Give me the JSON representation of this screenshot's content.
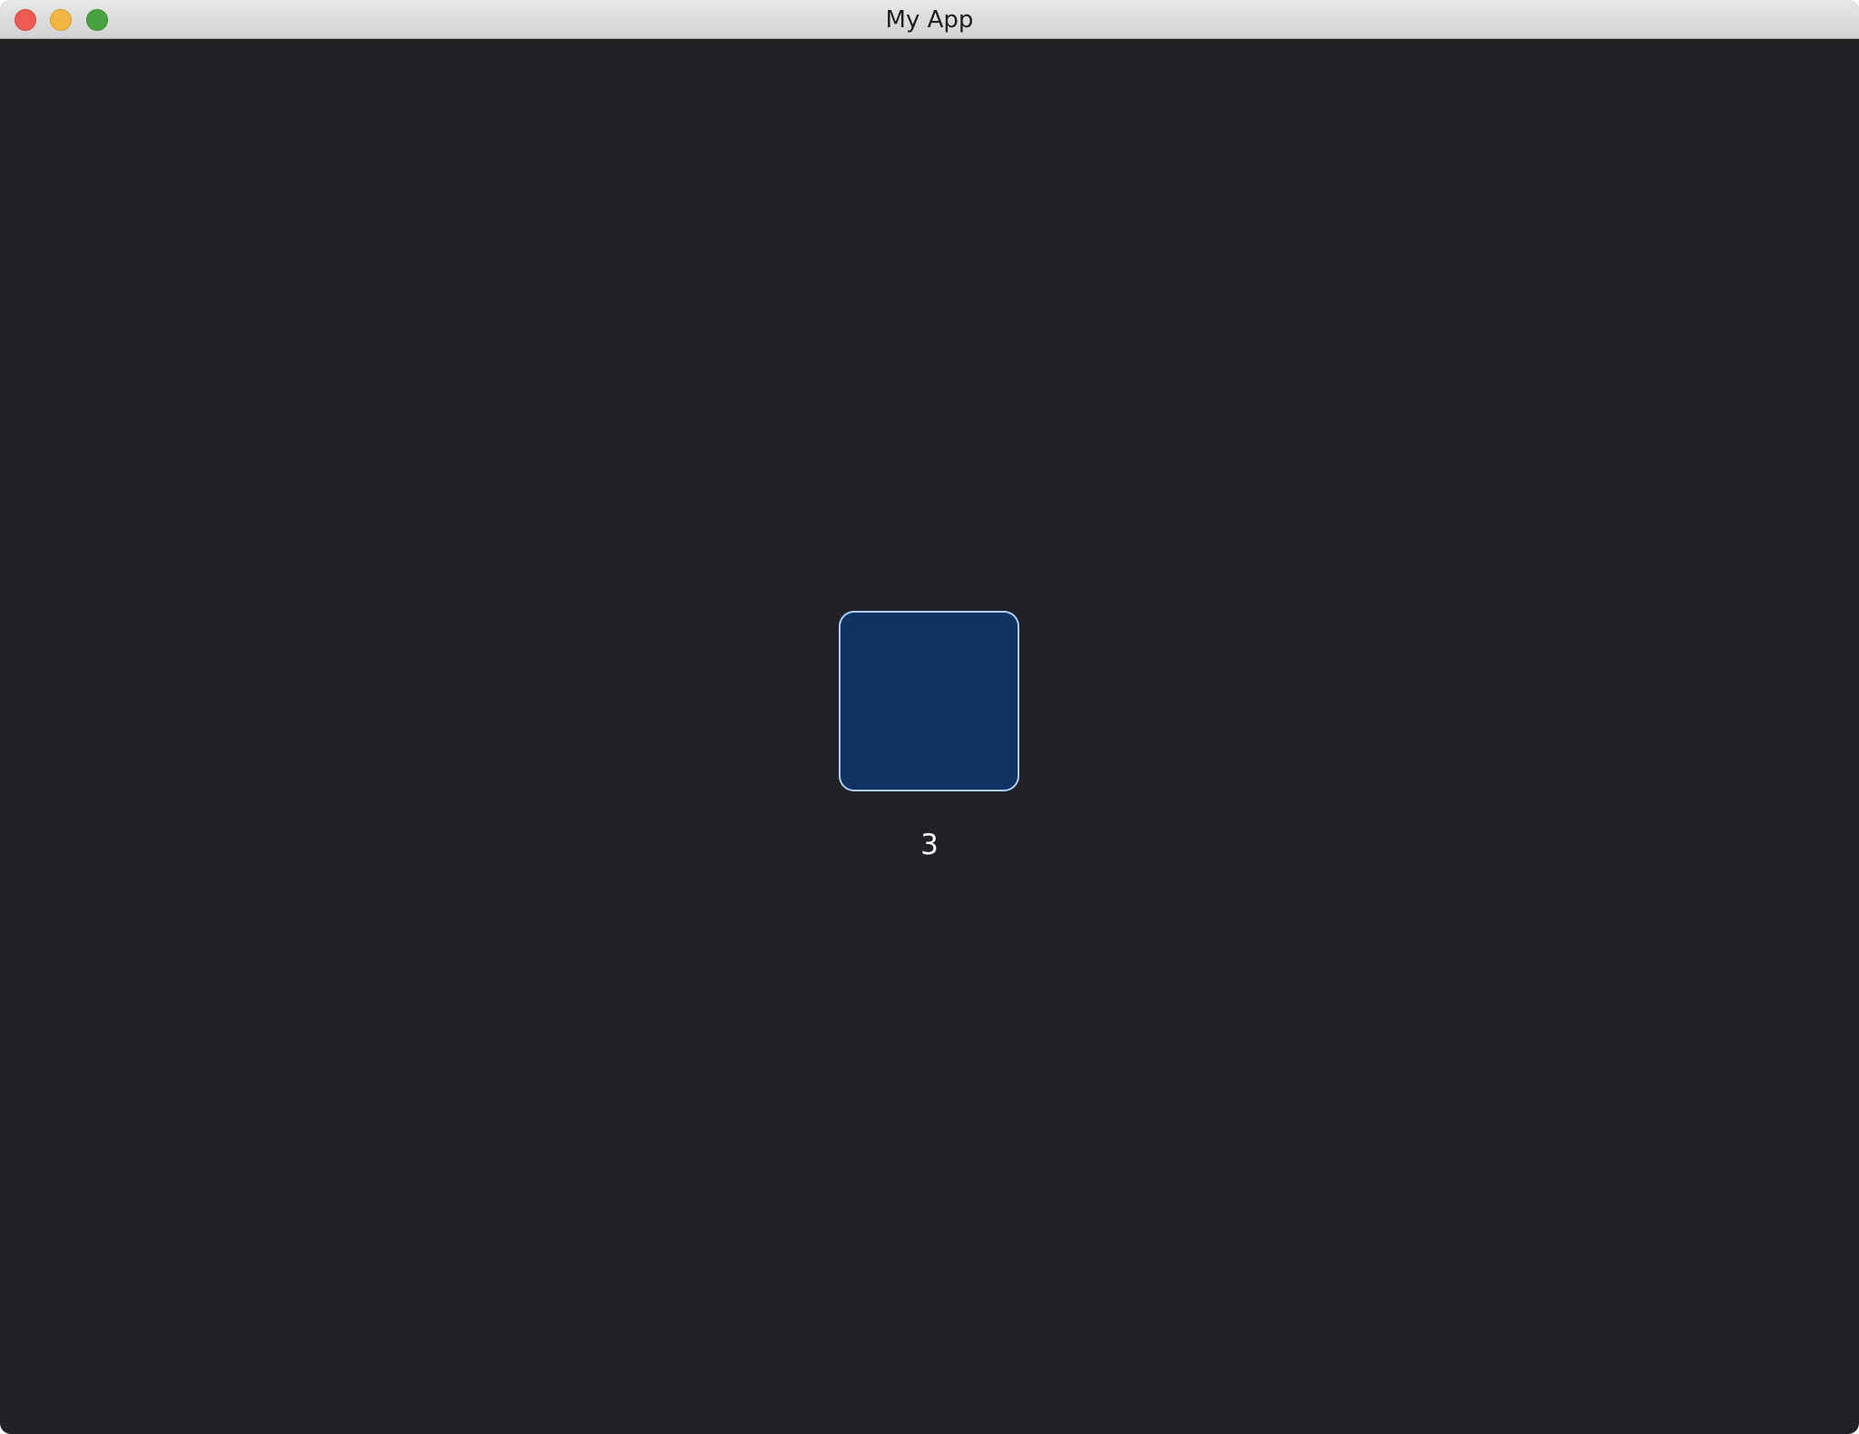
{
  "window": {
    "title": "My App"
  },
  "main": {
    "counter_value": "3"
  },
  "colors": {
    "background": "#212226",
    "square_fill": "#0f3362",
    "square_border": "#a9cff5",
    "text": "#ffffff"
  },
  "icons": {
    "close": "close-icon",
    "minimize": "minimize-icon",
    "zoom": "zoom-icon"
  }
}
